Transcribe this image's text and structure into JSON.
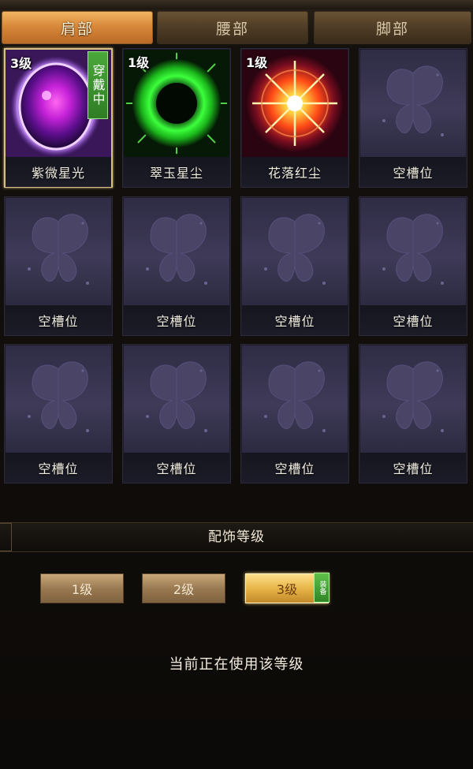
{
  "tabs": [
    {
      "label": "肩部",
      "active": true
    },
    {
      "label": "腰部",
      "active": false
    },
    {
      "label": "脚部",
      "active": false
    }
  ],
  "slots": [
    {
      "name": "紫微星光",
      "level": "3级",
      "wearing": "穿戴中",
      "icon": "purple-orb-icon",
      "color": "#c04cff"
    },
    {
      "name": "翠玉星尘",
      "level": "1级",
      "wearing": "",
      "icon": "green-burst-icon",
      "color": "#2ee53a"
    },
    {
      "name": "花落红尘",
      "level": "1级",
      "wearing": "",
      "icon": "red-star-burst-icon",
      "color": "#ff5a2a"
    },
    {
      "name": "空槽位",
      "level": "",
      "wearing": "",
      "icon": "butterfly-placeholder-icon"
    },
    {
      "name": "空槽位",
      "level": "",
      "wearing": "",
      "icon": "butterfly-placeholder-icon"
    },
    {
      "name": "空槽位",
      "level": "",
      "wearing": "",
      "icon": "butterfly-placeholder-icon"
    },
    {
      "name": "空槽位",
      "level": "",
      "wearing": "",
      "icon": "butterfly-placeholder-icon"
    },
    {
      "name": "空槽位",
      "level": "",
      "wearing": "",
      "icon": "butterfly-placeholder-icon"
    },
    {
      "name": "空槽位",
      "level": "",
      "wearing": "",
      "icon": "butterfly-placeholder-icon"
    },
    {
      "name": "空槽位",
      "level": "",
      "wearing": "",
      "icon": "butterfly-placeholder-icon"
    },
    {
      "name": "空槽位",
      "level": "",
      "wearing": "",
      "icon": "butterfly-placeholder-icon"
    },
    {
      "name": "空槽位",
      "level": "",
      "wearing": "",
      "icon": "butterfly-placeholder-icon"
    }
  ],
  "section": {
    "title": "配饰等级"
  },
  "levels": [
    {
      "label": "1级",
      "selected": false
    },
    {
      "label": "2级",
      "selected": false
    },
    {
      "label": "3级",
      "selected": true,
      "tag": "装备"
    }
  ],
  "status_text": "当前正在使用该等级"
}
